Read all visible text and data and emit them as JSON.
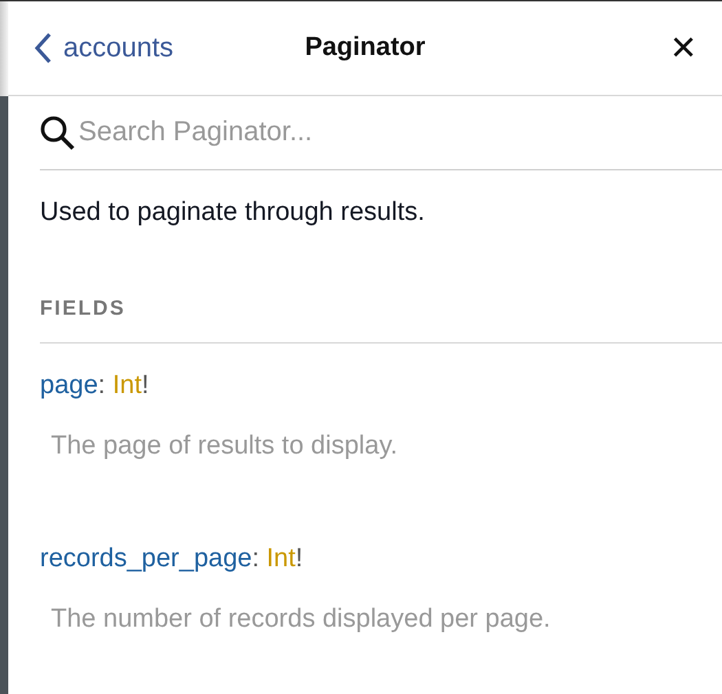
{
  "header": {
    "back_label": "accounts",
    "title": "Paginator",
    "close": "✕"
  },
  "search": {
    "placeholder": "Search Paginator..."
  },
  "description": "Used to paginate through results.",
  "section": {
    "title": "FIELDS"
  },
  "fields": [
    {
      "name": "page",
      "separator": ":",
      "type": "Int",
      "suffix": "!",
      "description": "The page of results to display."
    },
    {
      "name": "records_per_page",
      "separator": ":",
      "type": "Int",
      "suffix": "!",
      "description": "The number of records displayed per page."
    }
  ]
}
